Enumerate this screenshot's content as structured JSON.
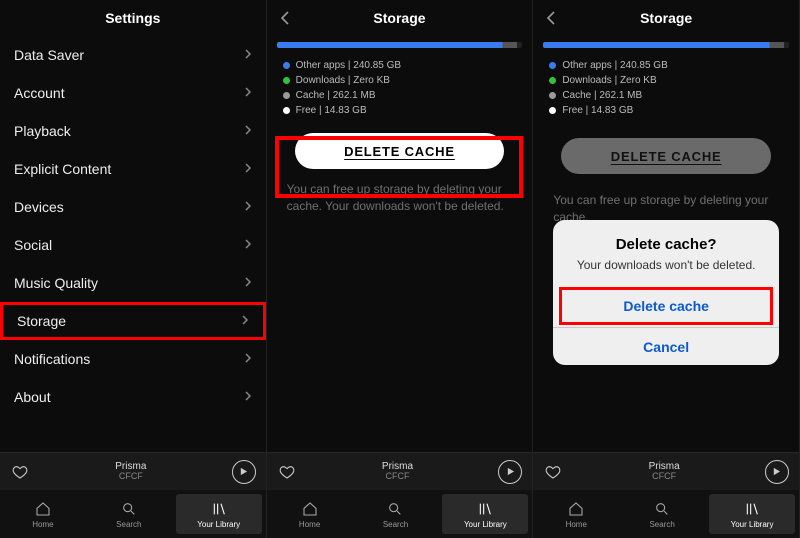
{
  "panel1": {
    "title": "Settings",
    "items": [
      {
        "label": "Data Saver"
      },
      {
        "label": "Account"
      },
      {
        "label": "Playback"
      },
      {
        "label": "Explicit Content"
      },
      {
        "label": "Devices"
      },
      {
        "label": "Social"
      },
      {
        "label": "Music Quality"
      },
      {
        "label": "Storage"
      },
      {
        "label": "Notifications"
      },
      {
        "label": "About"
      }
    ]
  },
  "panel2": {
    "title": "Storage",
    "legend": [
      {
        "color": "#3a7cf0",
        "text": "Other apps | 240.85 GB"
      },
      {
        "color": "#32c23a",
        "text": "Downloads | Zero KB"
      },
      {
        "color": "#9a9a9a",
        "text": "Cache | 262.1 MB"
      },
      {
        "color": "#ffffff",
        "text": "Free | 14.83 GB"
      }
    ],
    "delete_label": "DELETE CACHE",
    "helper": "You can free up storage by deleting your cache. Your downloads won't be deleted."
  },
  "panel3": {
    "title": "Storage",
    "legend": [
      {
        "color": "#3a7cf0",
        "text": "Other apps | 240.85 GB"
      },
      {
        "color": "#32c23a",
        "text": "Downloads | Zero KB"
      },
      {
        "color": "#9a9a9a",
        "text": "Cache | 262.1 MB"
      },
      {
        "color": "#ffffff",
        "text": "Free | 14.83 GB"
      }
    ],
    "delete_label": "DELETE CACHE",
    "helper": "You can free up storage by deleting your cache.",
    "dialog": {
      "title": "Delete cache?",
      "message": "Your downloads won't be deleted.",
      "confirm": "Delete cache",
      "cancel": "Cancel"
    }
  },
  "nowplaying": {
    "track": "Prisma",
    "artist": "CFCF"
  },
  "tabs": [
    {
      "id": "home",
      "label": "Home"
    },
    {
      "id": "search",
      "label": "Search"
    },
    {
      "id": "library",
      "label": "Your Library"
    }
  ],
  "colors": {
    "highlight": "#ff0000"
  }
}
